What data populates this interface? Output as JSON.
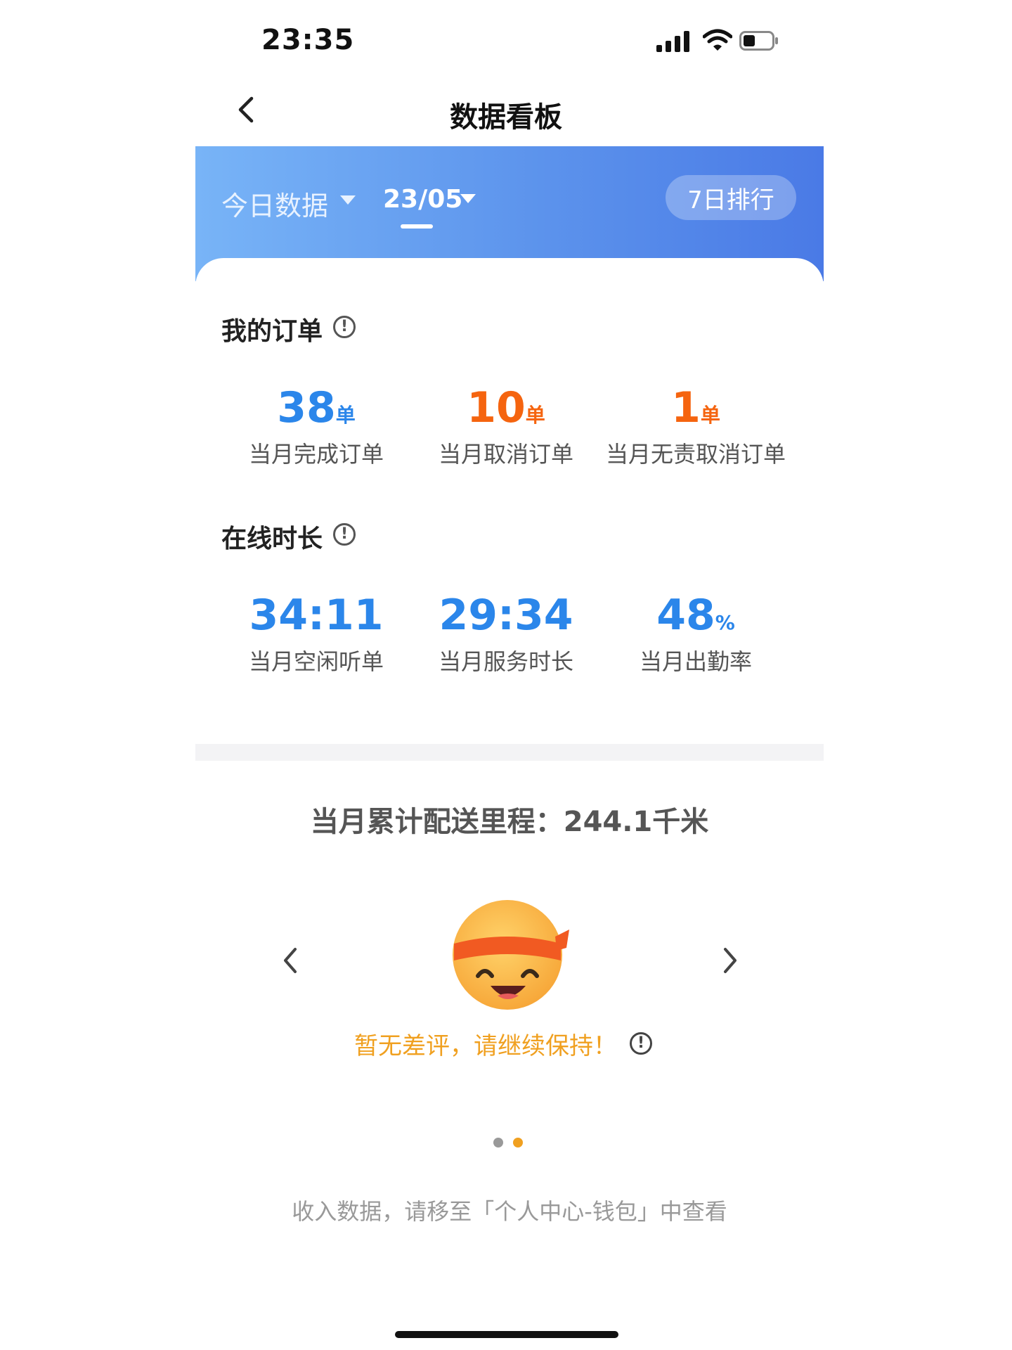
{
  "status_bar": {
    "time": "23:35"
  },
  "nav": {
    "title": "数据看板"
  },
  "banner": {
    "tab_today": "今日数据",
    "tab_date": "23/05",
    "rank_button": "7日排行"
  },
  "orders": {
    "title": "我的订单",
    "stats": [
      {
        "value": "38",
        "unit": "单",
        "label": "当月完成订单",
        "color": "#2b86ea"
      },
      {
        "value": "10",
        "unit": "单",
        "label": "当月取消订单",
        "color": "#f5640f"
      },
      {
        "value": "1",
        "unit": "单",
        "label": "当月无责取消订单",
        "color": "#f5640f"
      }
    ]
  },
  "online": {
    "title": "在线时长",
    "stats": [
      {
        "value": "34:11",
        "unit": "",
        "label": "当月空闲听单"
      },
      {
        "value": "29:34",
        "unit": "",
        "label": "当月服务时长"
      },
      {
        "value": "48",
        "unit": "%",
        "label": "当月出勤率"
      }
    ]
  },
  "mileage": {
    "text": "当月累计配送里程：244.1千米"
  },
  "review": {
    "text": "暂无差评，请继续保持！"
  },
  "pager": {
    "current": 2,
    "total": 2
  },
  "footer_note": "收入数据，请移至「个人中心-钱包」中查看",
  "icons": {
    "back": "chevron-left-icon",
    "info": "info-icon",
    "prev": "chevron-left-icon",
    "next": "chevron-right-icon",
    "emoji": "smiley-headband-icon"
  },
  "colors": {
    "accent_blue": "#2b86ea",
    "accent_orange": "#f5640f",
    "review_yellow": "#f0a020"
  }
}
